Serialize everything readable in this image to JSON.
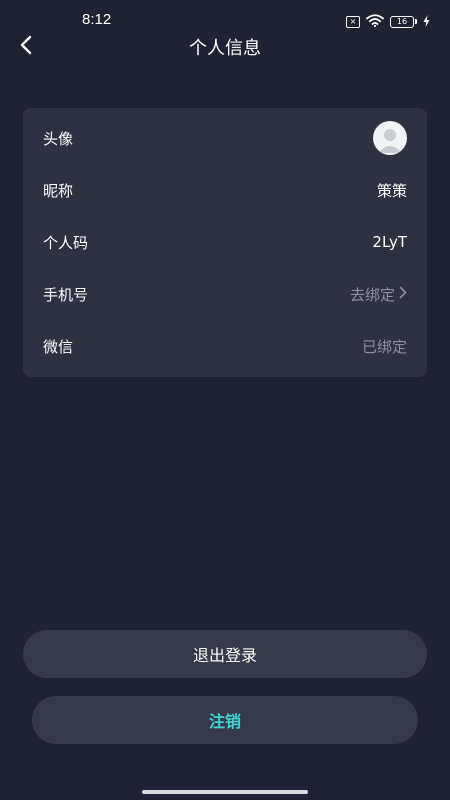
{
  "status_bar": {
    "time": "8:12",
    "battery_level": "16",
    "icons": [
      "sim-error-icon",
      "wifi-icon",
      "battery-icon",
      "charging-icon"
    ]
  },
  "header": {
    "title": "个人信息",
    "back_icon": "chevron-left-icon"
  },
  "profile": {
    "rows": [
      {
        "label": "头像",
        "value": ""
      },
      {
        "label": "昵称",
        "value": "策策"
      },
      {
        "label": "个人码",
        "value": "2LyT"
      },
      {
        "label": "手机号",
        "value": "去绑定"
      },
      {
        "label": "微信",
        "value": "已绑定"
      }
    ]
  },
  "actions": {
    "logout_label": "退出登录",
    "cancel_account_label": "注销"
  },
  "colors": {
    "background": "#1f2233",
    "card": "#2e3142",
    "button": "#363949",
    "accent": "#3ed6d2",
    "muted_text": "#8e909e"
  }
}
